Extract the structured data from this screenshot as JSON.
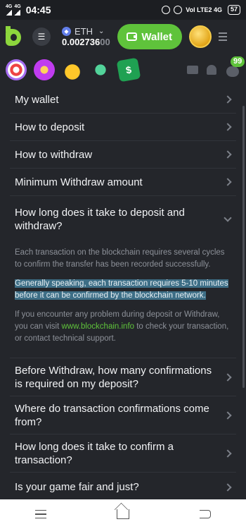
{
  "status_bar": {
    "network1": "4G",
    "network2": "4G",
    "time": "04:45",
    "right_text": "Vol LTE2 4G",
    "battery": "57"
  },
  "header": {
    "currency": "ETH",
    "balance_main": "0.002736",
    "balance_dim": "00",
    "wallet_label": "Wallet"
  },
  "game_row": {
    "chat_badge": "99",
    "game5_glyph": "$"
  },
  "faq": {
    "items_top": [
      "My wallet",
      "How to deposit",
      "How to withdraw",
      "Minimum Withdraw amount"
    ],
    "open_question": "How long does it take to deposit and withdraw?",
    "answer": {
      "p1": "Each transaction on the blockchain requires several cycles to confirm the transfer has been recorded successfully.",
      "p2": "Generally speaking, each transaction requires 5-10 minutes before it can be confirmed by the blockchain network.",
      "p3_before": "If you encounter any problem during deposit or Withdraw, you can visit ",
      "p3_link": "www.blockchain.info",
      "p3_after": " to check your transaction, or contact technical support."
    },
    "items_bottom": [
      "Before Withdraw, how many confirmations is required on my deposit?",
      "Where do transaction confirmations come from?",
      "How long does it take to confirm a transaction?",
      "Is your game fair and just?"
    ]
  },
  "colors": {
    "accent": "#5fc33b",
    "background": "#24262b",
    "highlight": "#3d6e86"
  }
}
